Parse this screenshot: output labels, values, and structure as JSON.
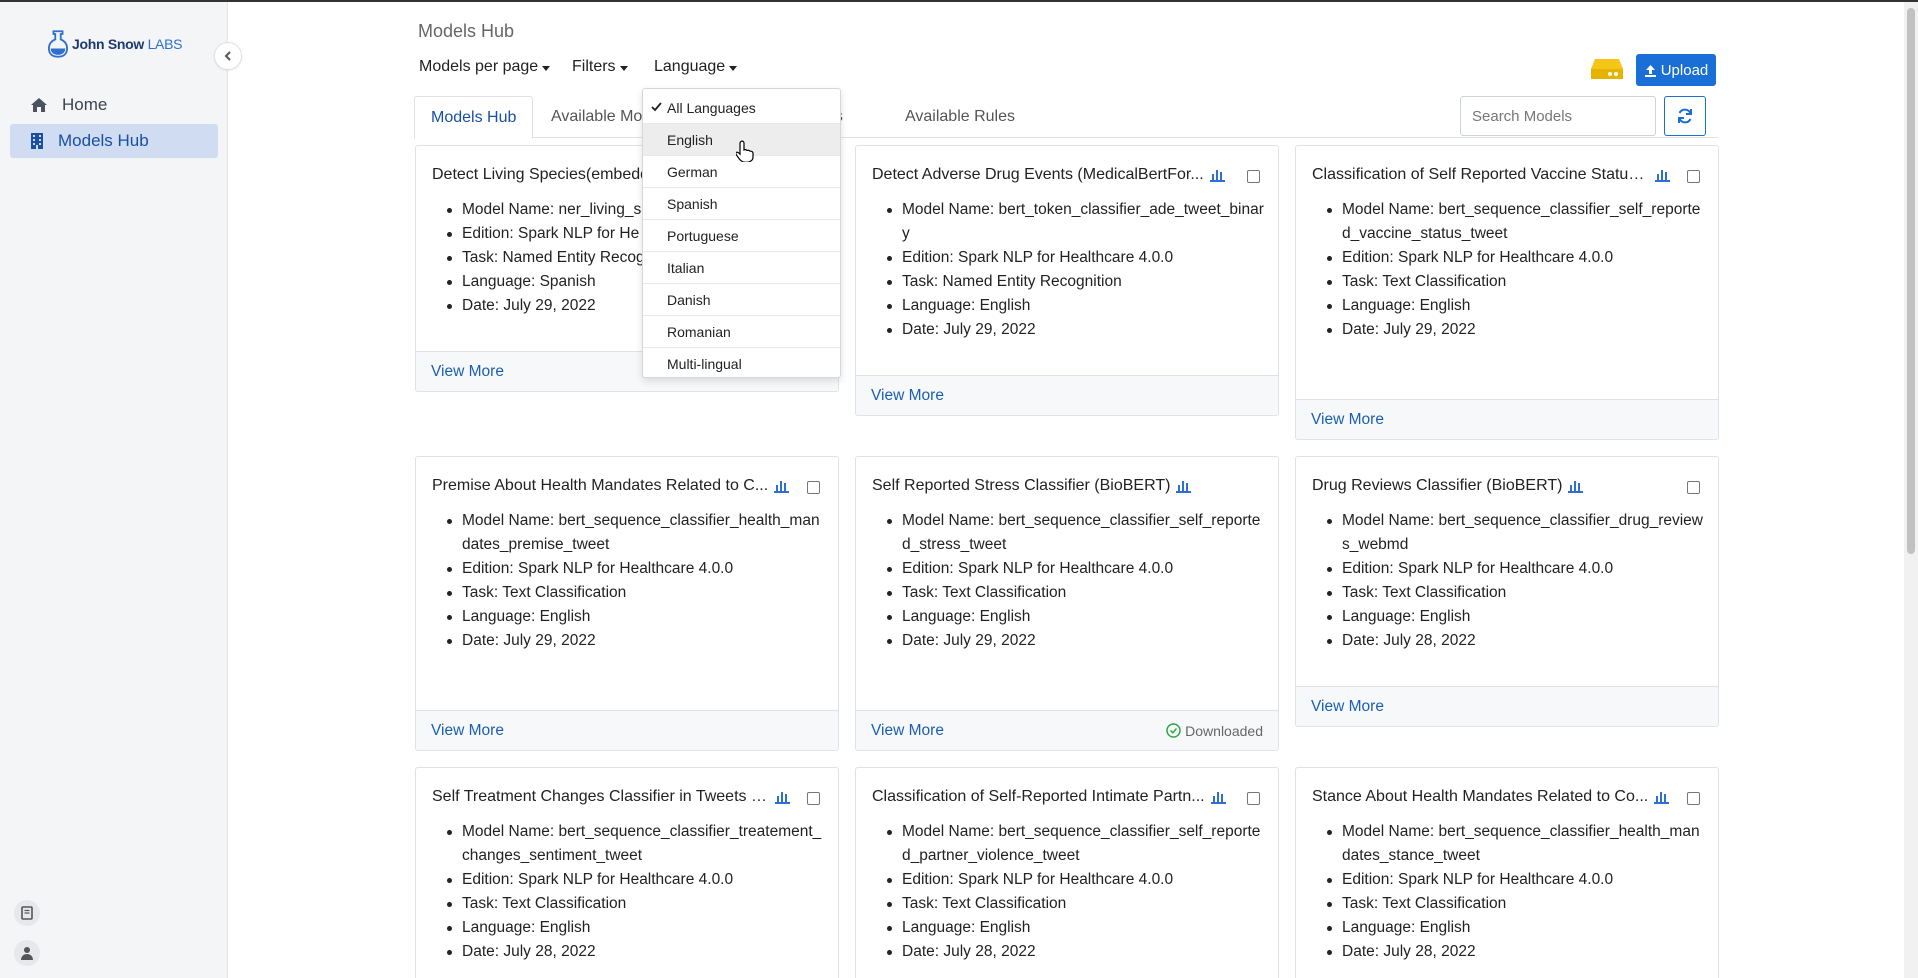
{
  "brand": {
    "name": "John Snow",
    "suffix": "LABS"
  },
  "sidebar": {
    "items": [
      {
        "label": "Home",
        "active": false
      },
      {
        "label": "Models Hub",
        "active": true
      }
    ]
  },
  "page": {
    "title": "Models Hub"
  },
  "toolbar": {
    "models_per_page": "Models per page",
    "filters": "Filters",
    "language": "Language",
    "upload_label": "Upload"
  },
  "tabs": [
    {
      "label": "Models Hub",
      "active": true
    },
    {
      "label": "Available Mo",
      "active": false
    },
    {
      "label": "gs",
      "active": false
    },
    {
      "label": "Available Rules",
      "active": false
    }
  ],
  "search": {
    "placeholder": "Search Models"
  },
  "language_menu": {
    "items": [
      {
        "label": "All Languages",
        "selected": true
      },
      {
        "label": "English",
        "hover": true
      },
      {
        "label": "German"
      },
      {
        "label": "Spanish"
      },
      {
        "label": "Portuguese"
      },
      {
        "label": "Italian"
      },
      {
        "label": "Danish"
      },
      {
        "label": "Romanian"
      },
      {
        "label": "Multi-lingual"
      }
    ]
  },
  "cards": [
    {
      "title": "Detect Living Species(embedd",
      "lines": [
        "Model Name: ner_living_s",
        "Edition: Spark NLP for He",
        "Task: Named Entity Recog",
        "Language: Spanish",
        "Date: July 29, 2022"
      ],
      "footer": "View More",
      "status": ""
    },
    {
      "title": "Detect Adverse Drug Events (MedicalBertFor...",
      "lines": [
        "Model Name: bert_token_classifier_ade_tweet_binary",
        "Edition: Spark NLP for Healthcare 4.0.0",
        "Task: Named Entity Recognition",
        "Language: English",
        "Date: July 29, 2022"
      ],
      "footer": "View More",
      "status": ""
    },
    {
      "title": "Classification of Self Reported Vaccine Status...",
      "lines": [
        "Model Name: bert_sequence_classifier_self_reported_vaccine_status_tweet",
        "Edition: Spark NLP for Healthcare 4.0.0",
        "Task: Text Classification",
        "Language: English",
        "Date: July 29, 2022"
      ],
      "footer": "View More",
      "status": ""
    },
    {
      "title": "Premise About Health Mandates Related to C...",
      "lines": [
        "Model Name: bert_sequence_classifier_health_mandates_premise_tweet",
        "Edition: Spark NLP for Healthcare 4.0.0",
        "Task: Text Classification",
        "Language: English",
        "Date: July 29, 2022"
      ],
      "footer": "View More",
      "status": ""
    },
    {
      "title": "Self Reported Stress Classifier (BioBERT)",
      "lines": [
        "Model Name: bert_sequence_classifier_self_reported_stress_tweet",
        "Edition: Spark NLP for Healthcare 4.0.0",
        "Task: Text Classification",
        "Language: English",
        "Date: July 29, 2022"
      ],
      "footer": "View More",
      "status": "Downloaded"
    },
    {
      "title": "Drug Reviews Classifier (BioBERT)",
      "lines": [
        "Model Name: bert_sequence_classifier_drug_reviews_webmd",
        "Edition: Spark NLP for Healthcare 4.0.0",
        "Task: Text Classification",
        "Language: English",
        "Date: July 28, 2022"
      ],
      "footer": "View More",
      "status": ""
    },
    {
      "title": "Self Treatment Changes Classifier in Tweets (...",
      "lines": [
        "Model Name: bert_sequence_classifier_treatement_changes_sentiment_tweet",
        "Edition: Spark NLP for Healthcare 4.0.0",
        "Task: Text Classification",
        "Language: English",
        "Date: July 28, 2022"
      ],
      "footer": "View More",
      "status": ""
    },
    {
      "title": "Classification of Self-Reported Intimate Partn...",
      "lines": [
        "Model Name: bert_sequence_classifier_self_reported_partner_violence_tweet",
        "Edition: Spark NLP for Healthcare 4.0.0",
        "Task: Text Classification",
        "Language: English",
        "Date: July 28, 2022"
      ],
      "footer": "View More",
      "status": ""
    },
    {
      "title": "Stance About Health Mandates Related to Co...",
      "lines": [
        "Model Name: bert_sequence_classifier_health_mandates_stance_tweet",
        "Edition: Spark NLP for Healthcare 4.0.0",
        "Task: Text Classification",
        "Language: English",
        "Date: July 28, 2022"
      ],
      "footer": "View More",
      "status": ""
    }
  ],
  "colors": {
    "accent": "#1a6fd6",
    "sidebar_active": "#cfdcf2",
    "link": "#1a5fb4",
    "server_icon": "#f5c518"
  }
}
